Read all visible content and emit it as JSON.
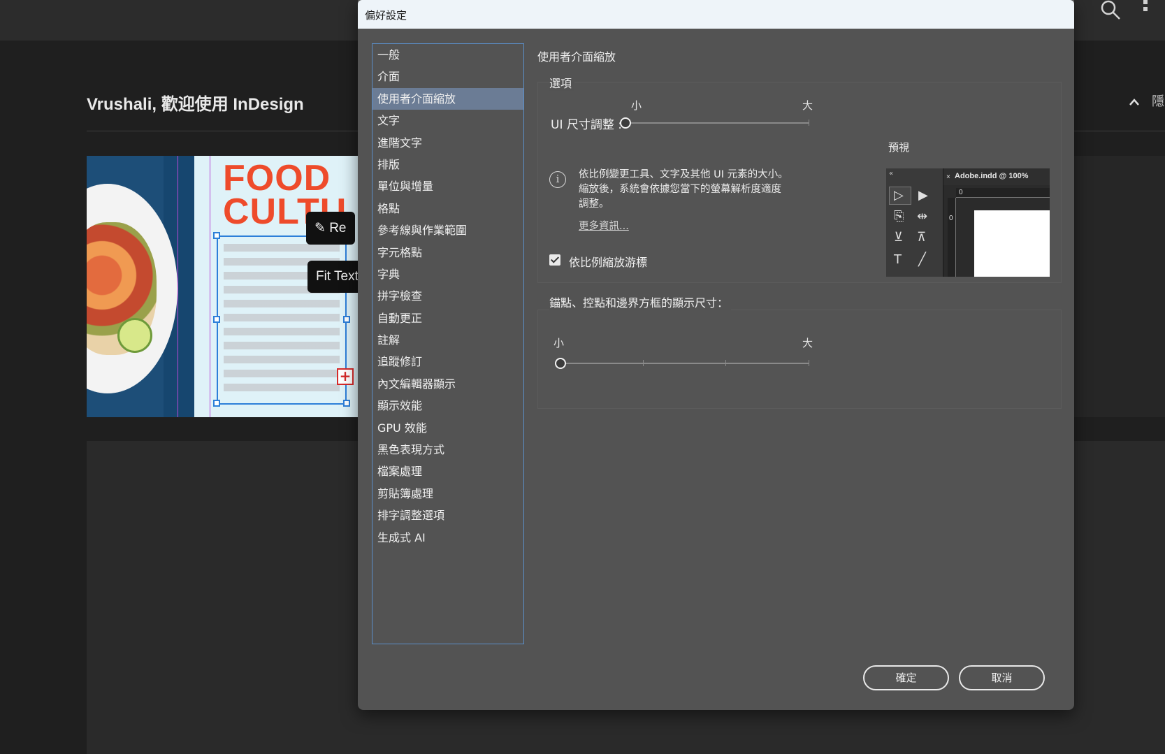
{
  "app": {
    "welcome": "Vrushali, 歡迎使用 InDesign",
    "hide_label": "隱",
    "promo": {
      "title_line1": "FOOD",
      "title_line2": "CULTU",
      "ctx_button_1": "Re",
      "ctx_button_2": "Fit Text"
    },
    "overflow_glyph": "+"
  },
  "dialog": {
    "title": "偏好設定",
    "categories": [
      "一般",
      "介面",
      "使用者介面縮放",
      "文字",
      "進階文字",
      "排版",
      "單位與增量",
      "格點",
      "參考線與作業範圍",
      "字元格點",
      "字典",
      "拼字檢查",
      "自動更正",
      "註解",
      "追蹤修訂",
      "內文編輯器顯示",
      "顯示效能",
      "GPU 效能",
      "黑色表現方式",
      "檔案處理",
      "剪貼簿處理",
      "排字調整選項",
      "生成式 AI"
    ],
    "selected_index": 2,
    "panel_title": "使用者介面縮放",
    "options_group": {
      "label": "選項",
      "ui_size_label": "UI 尺寸調整 :",
      "slider_min": "小",
      "slider_max": "大",
      "ui_size_value": 0,
      "info_text": "依比例變更工具、文字及其他 UI 元素的大小。縮放後，系統會依據您當下的螢幕解析度適度調整。",
      "more_info": "更多資訊...",
      "checkbox_label": "依比例縮放游標",
      "checkbox_checked": true,
      "preview_label": "預視",
      "preview": {
        "collapse": "«",
        "tab_close": "×",
        "tab_title": "Adobe.indd @ 100%",
        "ruler_h": "0",
        "ruler_v": "0"
      }
    },
    "anchors_group": {
      "label": "錨點、控點和邊界方框的顯示尺寸：",
      "slider_min": "小",
      "slider_max": "大",
      "value": 0
    },
    "ok_label": "確定",
    "cancel_label": "取消"
  },
  "colors": {
    "dialog_bg": "#535353",
    "selection": "#6b7c95",
    "list_border": "#5b8fc9"
  }
}
